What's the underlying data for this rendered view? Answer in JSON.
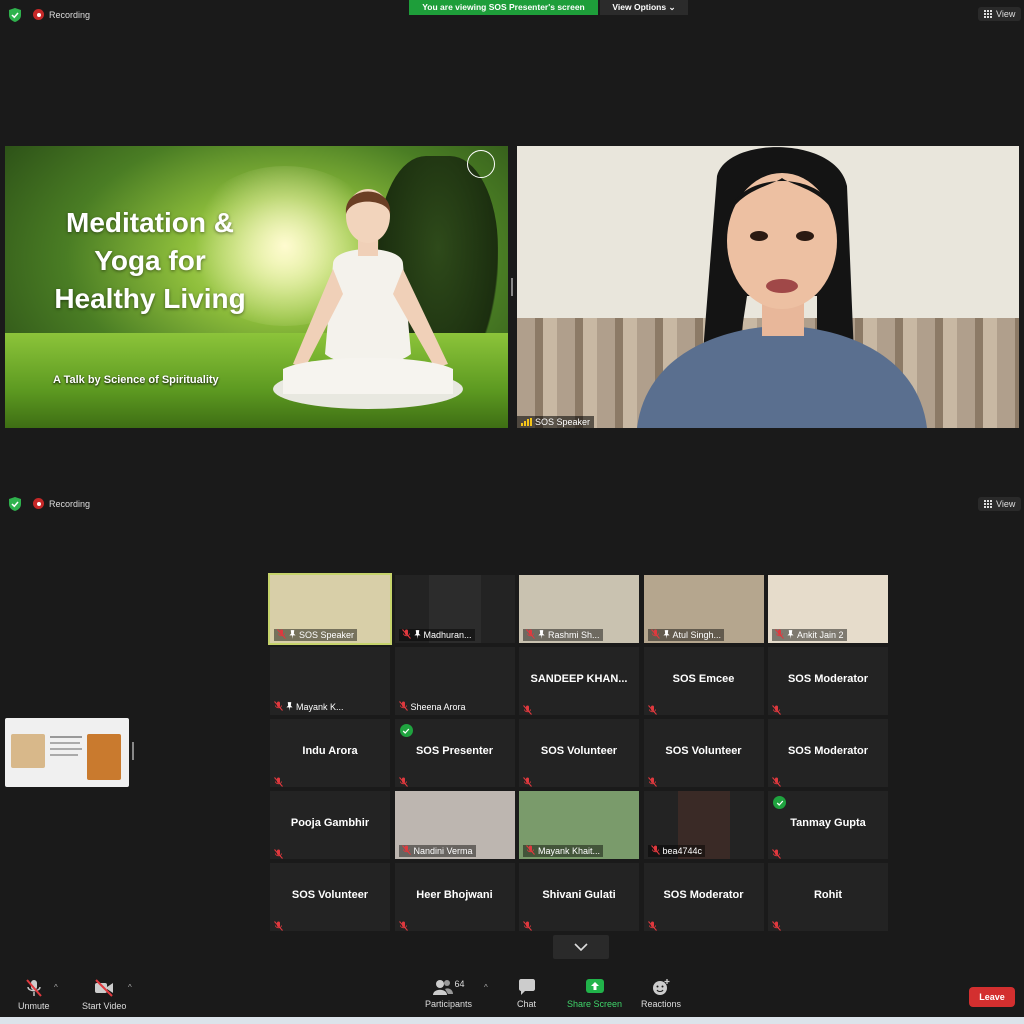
{
  "top_bar": {
    "recording_label": "Recording",
    "banner": "You are viewing SOS Presenter's screen",
    "view_options": "View Options",
    "view_label": "View"
  },
  "slide": {
    "title_line1": "Meditation &",
    "title_line2": "Yoga for",
    "title_line3": "Healthy Living",
    "subtitle": "A Talk by Science of Spirituality"
  },
  "speaker_video": {
    "name": "SOS Speaker"
  },
  "second_bar": {
    "recording_label": "Recording",
    "view_label": "View"
  },
  "gallery": [
    {
      "label": "SOS Speaker",
      "video": true,
      "active": true
    },
    {
      "label": "Madhuran...",
      "video": true
    },
    {
      "label": "Rashmi Sh...",
      "video": true
    },
    {
      "label": "Atul Singh...",
      "video": true
    },
    {
      "label": "Ankit Jain 2",
      "video": true
    },
    {
      "label": "Mayank K...",
      "video": false,
      "pinned": true
    },
    {
      "label": "Sheena Arora",
      "video": false
    },
    {
      "label": "SANDEEP  KHAN...",
      "video": false,
      "center": true
    },
    {
      "label": "SOS Emcee",
      "video": false,
      "center": true
    },
    {
      "label": "SOS Moderator",
      "video": false,
      "center": true
    },
    {
      "label": "Indu Arora",
      "video": false,
      "center": true
    },
    {
      "label": "SOS Presenter",
      "video": false,
      "center": true,
      "check": true
    },
    {
      "label": "SOS Volunteer",
      "video": false,
      "center": true
    },
    {
      "label": "SOS Volunteer",
      "video": false,
      "center": true
    },
    {
      "label": "SOS Moderator",
      "video": false,
      "center": true
    },
    {
      "label": "Pooja Gambhir",
      "video": false,
      "center": true
    },
    {
      "label": "Nandini Verma",
      "video": true
    },
    {
      "label": "Mayank Khait...",
      "video": true
    },
    {
      "label": "bea4744c",
      "video": true
    },
    {
      "label": "Tanmay Gupta",
      "video": false,
      "center": true,
      "check": true
    },
    {
      "label": "SOS Volunteer",
      "video": false,
      "center": true
    },
    {
      "label": "Heer Bhojwani",
      "video": false,
      "center": true
    },
    {
      "label": "Shivani Gulati",
      "video": false,
      "center": true
    },
    {
      "label": "SOS Moderator",
      "video": false,
      "center": true
    },
    {
      "label": "Rohit",
      "video": false,
      "center": true
    }
  ],
  "toolbar": {
    "unmute": "Unmute",
    "start_video": "Start Video",
    "participants": "Participants",
    "participants_count": "64",
    "chat": "Chat",
    "share_screen": "Share Screen",
    "reactions": "Reactions",
    "leave": "Leave"
  },
  "colors": {
    "accent_green": "#1e9e3a",
    "leave_red": "#d32f2f",
    "muted_red": "#e0393e"
  }
}
